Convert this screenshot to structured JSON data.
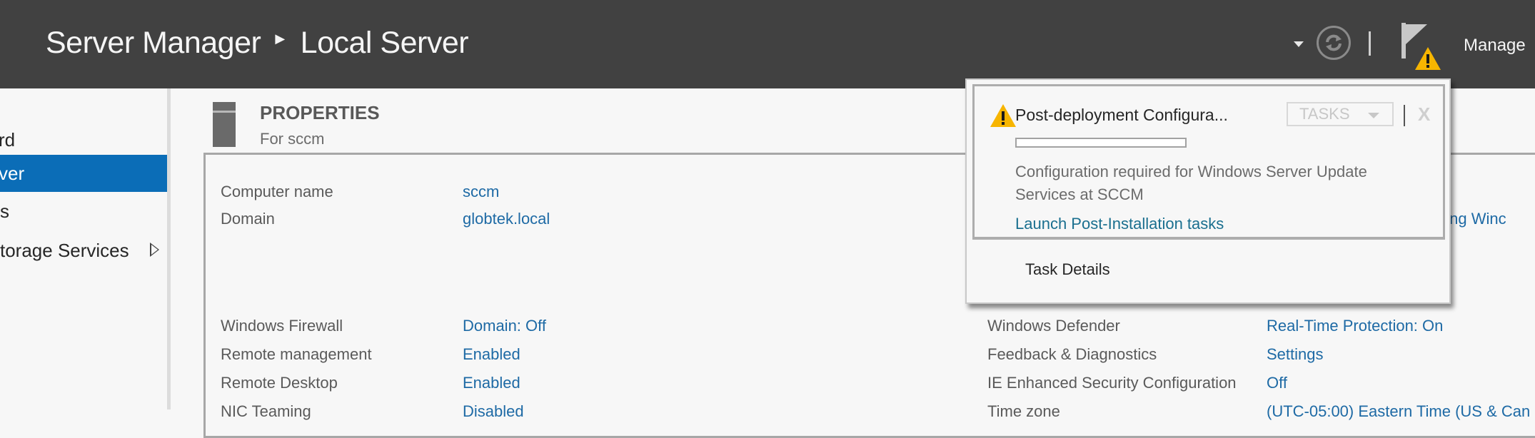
{
  "header": {
    "breadcrumb": [
      "Server Manager",
      "Local Server"
    ],
    "manage_label": "Manage",
    "notification_count_icon": "warning-icon"
  },
  "sidebar": {
    "items": [
      {
        "label": "rd",
        "full_label": "Dashboard",
        "active": false
      },
      {
        "label": "ver",
        "full_label": "Local Server",
        "active": true
      },
      {
        "label": "s",
        "full_label": "All Servers",
        "active": false
      },
      {
        "label": "torage Services",
        "full_label": "File and Storage Services",
        "active": false,
        "has_submenu": true
      }
    ]
  },
  "section": {
    "title": "PROPERTIES",
    "subtitle": "For sccm"
  },
  "properties_left": [
    {
      "label": "Computer name",
      "value": "sccm"
    },
    {
      "label": "Domain",
      "value": "globtek.local"
    },
    {
      "label": "Windows Firewall",
      "value": "Domain: Off"
    },
    {
      "label": "Remote management",
      "value": "Enabled"
    },
    {
      "label": "Remote Desktop",
      "value": "Enabled"
    },
    {
      "label": "NIC Teaming",
      "value": "Disabled"
    }
  ],
  "properties_right": [
    {
      "label": "",
      "value": "using Winc"
    },
    {
      "label": "Windows Defender",
      "value": "Real-Time Protection: On"
    },
    {
      "label": "Feedback & Diagnostics",
      "value": "Settings"
    },
    {
      "label": "IE Enhanced Security Configuration",
      "value": "Off"
    },
    {
      "label": "Time zone",
      "value": "(UTC-05:00) Eastern Time (US & Can"
    }
  ],
  "notification_popup": {
    "title": "Post-deployment Configura...",
    "tasks_label": "TASKS",
    "close_label": "X",
    "progress_percent": 0,
    "message": "Configuration required for Windows Server Update Services at SCCM",
    "link": "Launch Post-Installation tasks",
    "footer_item": "Task Details"
  },
  "colors": {
    "header_bg": "#414141",
    "accent": "#0b6db7",
    "link": "#1e6aa5",
    "warning": "#f7b500"
  }
}
